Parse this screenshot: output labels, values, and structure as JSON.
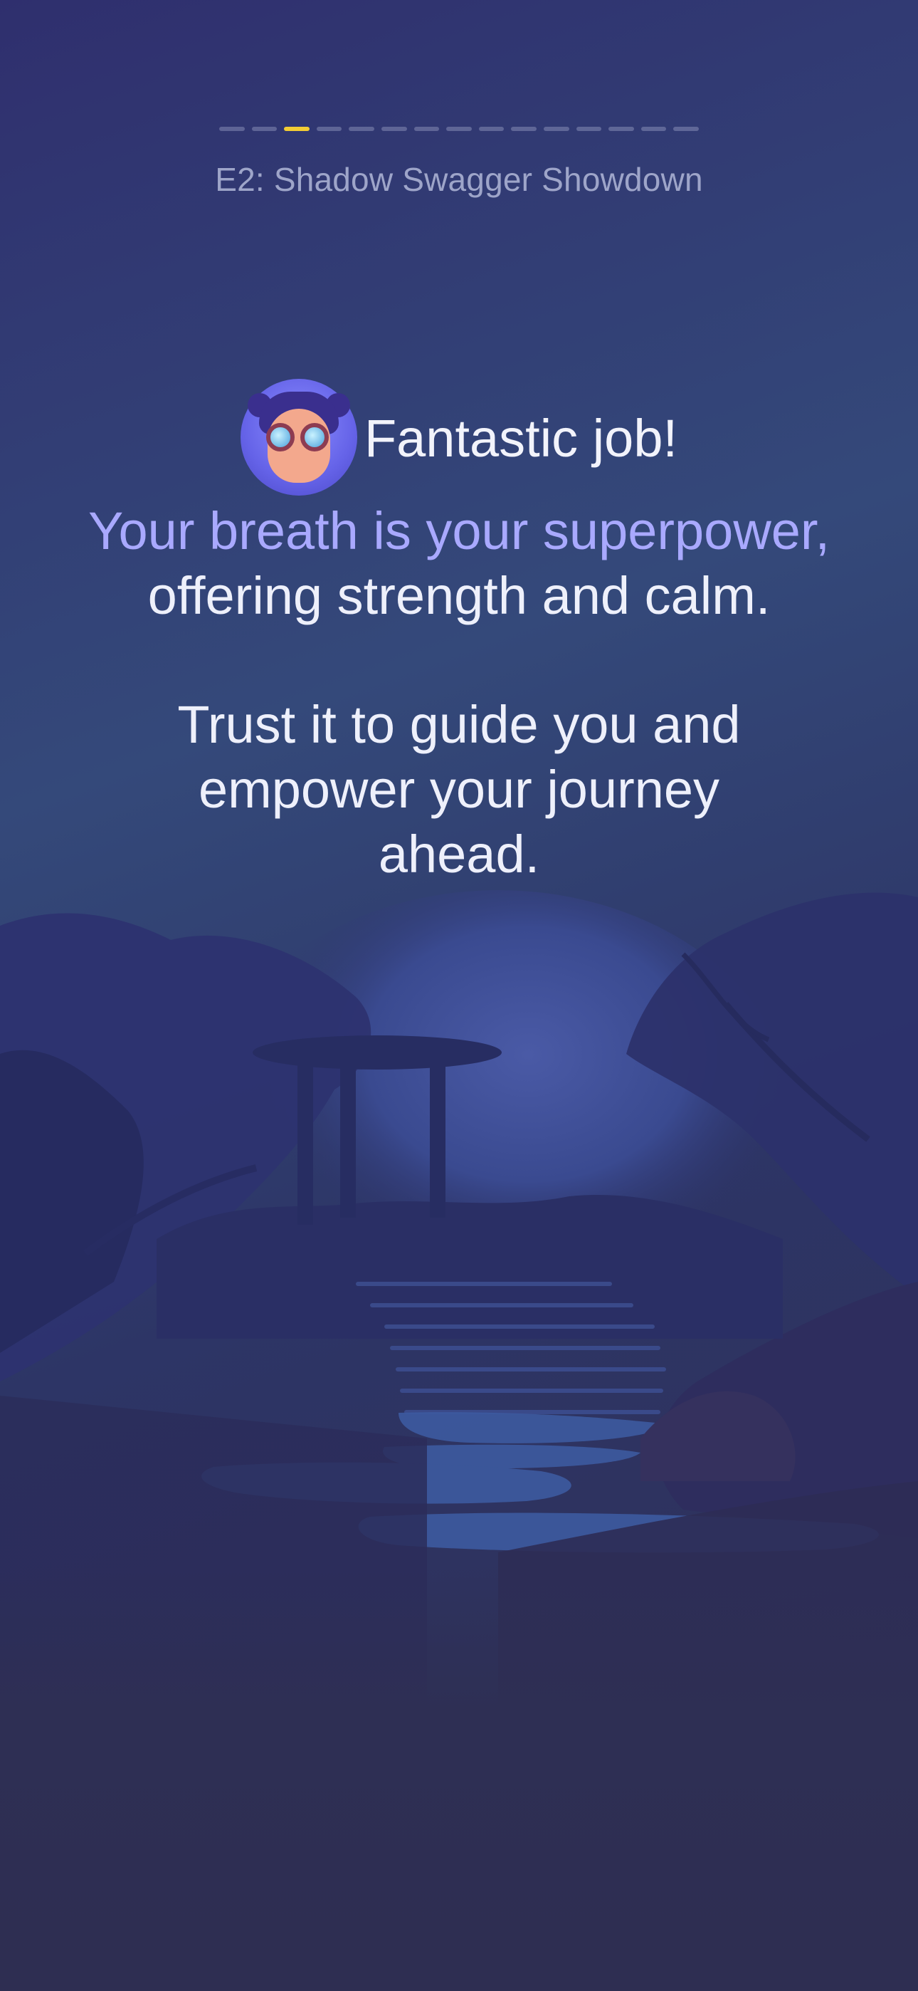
{
  "progress": {
    "total_segments": 15,
    "active_index": 2,
    "active_color": "#f2cc34",
    "inactive_color": "#8d90b3"
  },
  "episode_title": "E2: Shadow Swagger Showdown",
  "message": {
    "headline": "Fantastic job!",
    "accent_line": "Your breath is your superpower,",
    "line_2": "offering strength and calm.",
    "paragraph_2": [
      "Trust it to guide you and",
      "empower your journey",
      "ahead."
    ]
  },
  "colors": {
    "accent_text": "#a9a9ff",
    "body_text": "#eef0fb",
    "subtitle_text": "#9ea5c9"
  },
  "icons": {
    "avatar": "character-avatar-goggles"
  },
  "scene": "night forest with pavilion and stone steps"
}
